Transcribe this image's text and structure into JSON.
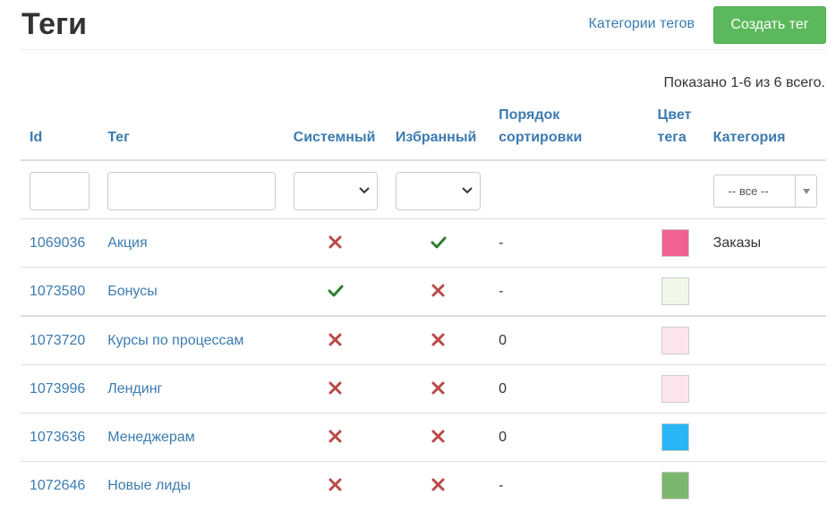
{
  "header": {
    "title": "Теги",
    "categories_link": "Категории тегов",
    "create_button": "Создать тег"
  },
  "summary": "Показано 1-6 из 6 всего.",
  "columns": {
    "id": "Id",
    "tag": "Тег",
    "system": "Системный",
    "favorite": "Избранный",
    "sort_order_line1": "Порядок",
    "sort_order_line2": "сортировки",
    "color_line1": "Цвет",
    "color_line2": "тега",
    "category": "Категория"
  },
  "filters": {
    "id_value": "",
    "tag_value": "",
    "system_selected": "",
    "favorite_selected": "",
    "category_selected": "-- все --"
  },
  "icons": {
    "check": "check-icon",
    "cross": "cross-icon",
    "check_color": "#2e7d32",
    "cross_color": "#b94a48"
  },
  "rows": [
    {
      "id": "1069036",
      "tag": "Акция",
      "system": false,
      "favorite": true,
      "order": "-",
      "color": "#f06292",
      "category": "Заказы"
    },
    {
      "id": "1073580",
      "tag": "Бонусы",
      "system": true,
      "favorite": false,
      "order": "-",
      "color": "#f1f8e9",
      "category": ""
    },
    {
      "id": "1073720",
      "tag": "Курсы по процессам",
      "system": false,
      "favorite": false,
      "order": "0",
      "color": "#fce4ec",
      "category": ""
    },
    {
      "id": "1073996",
      "tag": "Лендинг",
      "system": false,
      "favorite": false,
      "order": "0",
      "color": "#fce4ec",
      "category": ""
    },
    {
      "id": "1073636",
      "tag": "Менеджерам",
      "system": false,
      "favorite": false,
      "order": "0",
      "color": "#29b6f6",
      "category": ""
    },
    {
      "id": "1072646",
      "tag": "Новые лиды",
      "system": false,
      "favorite": false,
      "order": "-",
      "color": "#7cb76f",
      "category": ""
    }
  ],
  "theme": {
    "link_color": "#3c7bb0",
    "button_green": "#5cb85c"
  }
}
